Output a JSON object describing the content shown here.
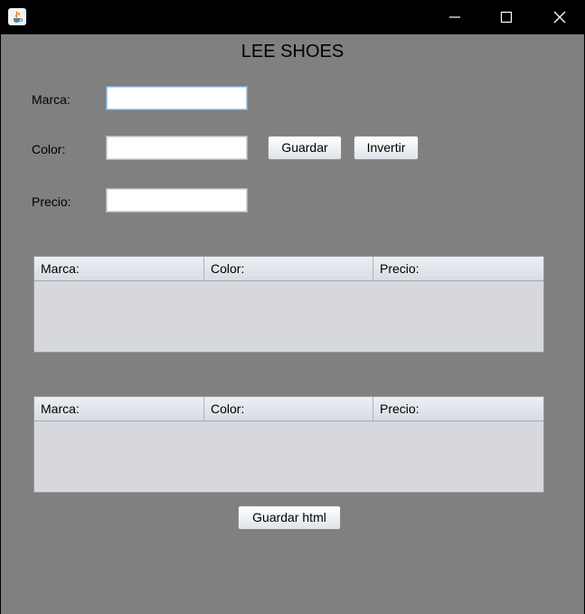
{
  "window": {
    "app_icon": "java-coffee-cup-icon",
    "controls": [
      "minimize-icon",
      "maximize-icon",
      "close-icon"
    ]
  },
  "app_title": "LEE SHOES",
  "form": {
    "marca_label": "Marca:",
    "marca_value": "",
    "color_label": "Color:",
    "color_value": "",
    "precio_label": "Precio:",
    "precio_value": ""
  },
  "buttons": {
    "guardar": "Guardar",
    "invertir": "Invertir",
    "guardar_html": "Guardar html"
  },
  "table1": {
    "columns": [
      "Marca:",
      "Color:",
      "Precio:"
    ],
    "rows": []
  },
  "table2": {
    "columns": [
      "Marca:",
      "Color:",
      "Precio:"
    ],
    "rows": []
  },
  "colors": {
    "background": "#808080",
    "table_bg": "#d6d8de",
    "titlebar": "#000000"
  }
}
